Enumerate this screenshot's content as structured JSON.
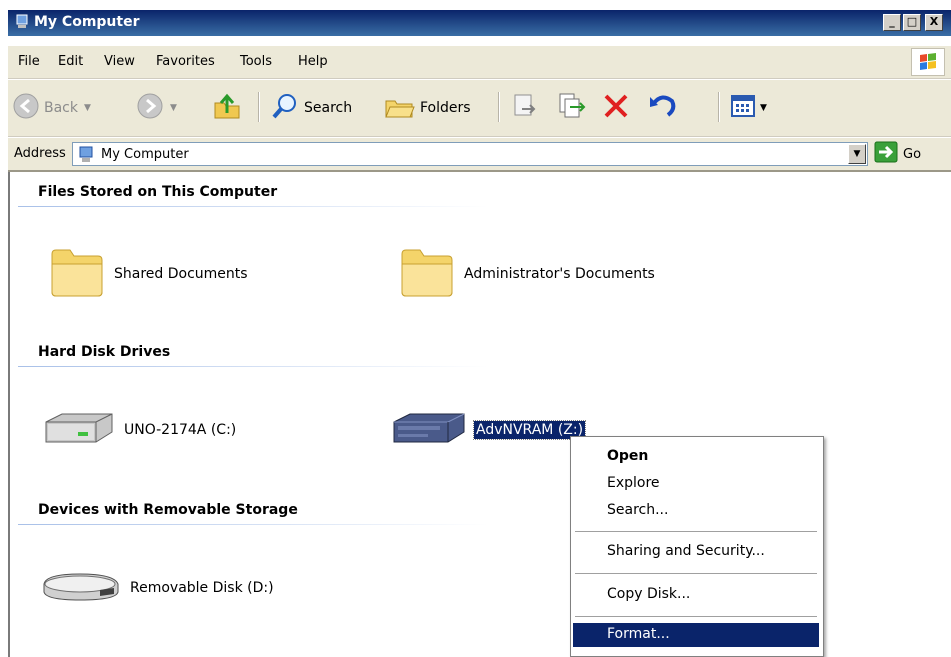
{
  "window": {
    "title": "My Computer",
    "minimize_label": "_",
    "maximize_label": "□",
    "close_label": "X"
  },
  "menubar": {
    "items": [
      "File",
      "Edit",
      "View",
      "Favorites",
      "Tools",
      "Help"
    ]
  },
  "toolbar": {
    "back_label": "Back",
    "search_label": "Search",
    "folders_label": "Folders"
  },
  "address": {
    "label": "Address",
    "value": "My Computer",
    "go_label": "Go"
  },
  "groups": {
    "files": {
      "title": "Files Stored on This Computer",
      "items": [
        "Shared Documents",
        "Administrator's Documents"
      ]
    },
    "drives": {
      "title": "Hard Disk Drives",
      "items": [
        "UNO-2174A (C:)",
        "AdvNVRAM (Z:)"
      ]
    },
    "removable": {
      "title": "Devices with Removable Storage",
      "items": [
        "Removable Disk (D:)"
      ]
    }
  },
  "context_menu": {
    "open": "Open",
    "explore": "Explore",
    "search": "Search...",
    "sharing": "Sharing and Security...",
    "copy_disk": "Copy Disk...",
    "format": "Format..."
  },
  "colors": {
    "selection": "#0a246a",
    "toolbar_bg": "#ece9d8",
    "folder_yellow": "#f4d46a",
    "delete_red": "#e02020"
  },
  "icons": {
    "title": "my-computer-icon",
    "back": "back-arrow-icon",
    "forward": "forward-arrow-icon",
    "up": "up-folder-icon",
    "search": "search-magnifier-icon",
    "folders": "folders-icon",
    "move_to": "move-to-icon",
    "copy_to": "copy-to-icon",
    "delete": "delete-x-icon",
    "undo": "undo-icon",
    "views": "views-icon",
    "go": "go-arrow-icon",
    "folder": "folder-icon",
    "hard_disk": "hard-disk-icon",
    "nvram_drive": "network-drive-icon",
    "removable_disk": "removable-disk-icon"
  }
}
